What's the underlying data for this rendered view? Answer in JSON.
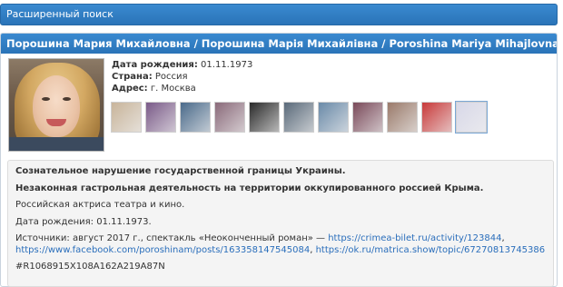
{
  "search": {
    "title": "Расширенный поиск"
  },
  "person": {
    "name_header": "Порошина Мария Михайловна / Порошина Марія Михайлівна / Poroshina Mariya Mihajlovna",
    "birth_label": "Дата рождения:",
    "birth_value": "01.11.1973",
    "country_label": "Страна:",
    "country_value": "Россия",
    "address_label": "Адрес:",
    "address_value": "г. Москва"
  },
  "description": {
    "line1": "Сознательное нарушение государственной границы Украины.",
    "line2": "Незаконная гастрольная деятельность на территории оккупированного россией Крыма.",
    "line3": "Российская актриса театра и кино.",
    "line4": "Дата рождения: 01.11.1973.",
    "sources_prefix": "Источники:  август 2017 г., спектакль «Неоконченный роман» — ",
    "link1": "https://crimea-bilet.ru/activity/123844",
    "sep1": ",",
    "link2": "https://www.facebook.com/poroshinam/posts/163358147545084",
    "sep2": ", ",
    "link3": "https://ok.ru/matrica.show/topic/67270813745386",
    "hash": "#R1068915X108A162A219A87N"
  },
  "thumbnails": [
    {
      "color": "#c8b49a"
    },
    {
      "color": "#7a5a88"
    },
    {
      "color": "#4a6a8a"
    },
    {
      "color": "#8a6a7a"
    },
    {
      "color": "#2a2a2a"
    },
    {
      "color": "#5a6a7a"
    },
    {
      "color": "#6a8aa8"
    },
    {
      "color": "#7a4a5a"
    },
    {
      "color": "#9a7a6a"
    },
    {
      "color": "#c83a3a"
    },
    {
      "color": "#d8d8e8"
    }
  ]
}
